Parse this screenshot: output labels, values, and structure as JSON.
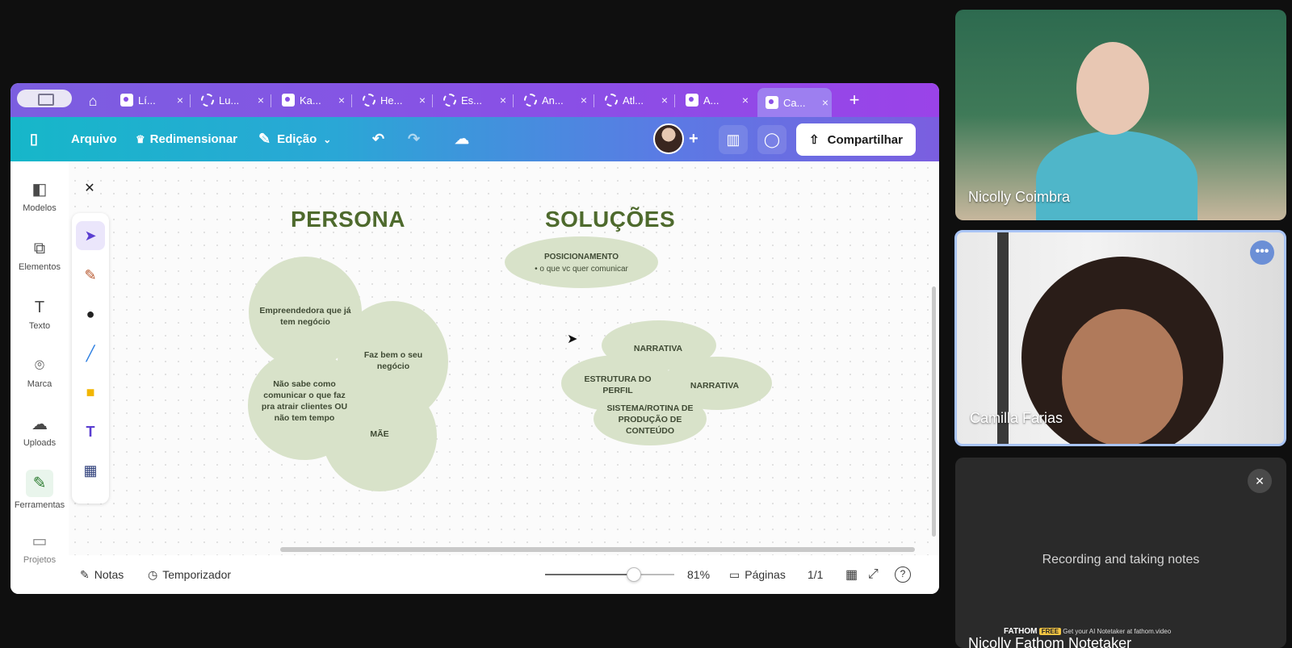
{
  "tabs": [
    {
      "title": "Lí...",
      "icon": "canva-icon",
      "active": false
    },
    {
      "title": "Lu...",
      "icon": "dashed-circle-icon",
      "active": false
    },
    {
      "title": "Ka...",
      "icon": "canva-icon",
      "active": false
    },
    {
      "title": "He...",
      "icon": "dashed-circle-icon",
      "active": false
    },
    {
      "title": "Es...",
      "icon": "dashed-circle-icon",
      "active": false
    },
    {
      "title": "An...",
      "icon": "dashed-circle-icon",
      "active": false
    },
    {
      "title": "Atl...",
      "icon": "dashed-circle-icon",
      "active": false
    },
    {
      "title": "A...",
      "icon": "canva-icon",
      "active": false
    },
    {
      "title": "Ca...",
      "icon": "canva-icon",
      "active": true
    }
  ],
  "tab_close": "×",
  "tab_new": "+",
  "toolbar": {
    "file": "Arquivo",
    "resize": "Redimensionar",
    "edit": "Edição",
    "share": "Compartilhar",
    "add": "+"
  },
  "rail": {
    "templates": "Modelos",
    "elements": "Elementos",
    "text": "Texto",
    "brand": "Marca",
    "uploads": "Uploads",
    "tools": "Ferramentas",
    "projects": "Projetos"
  },
  "canvas": {
    "persona_title": "PERSONA",
    "solucoes_title": "SOLUÇÕES",
    "persona_items": [
      "Empreendedora que já tem negócio",
      "Faz bem o seu negócio",
      "Não sabe como comunicar o que faz pra atrair clientes OU não tem tempo",
      "MÃE"
    ],
    "posicionamento": "POSICIONAMENTO",
    "posicionamento_bullet": "o que vc quer comunicar",
    "narrativa_top": "NARRATIVA",
    "estrutura": "ESTRUTURA DO PERFIL",
    "narrativa_right": "NARRATIVA",
    "sistema": "SISTEMA/ROTINA DE PRODUÇÃO DE CONTEÚDO"
  },
  "bottom": {
    "notes": "Notas",
    "timer": "Temporizador",
    "zoom": "81%",
    "zoom_value": 0.69,
    "pages": "Páginas",
    "page_count": "1/1",
    "help": "?"
  },
  "participants": {
    "p1": "Nicolly Coimbra",
    "p2": "Camilla Farias",
    "p3": "Nicolly Fathom Notetaker",
    "status": "Recording and taking notes",
    "fathom_logo": "FATHOM",
    "fathom_free": "FREE",
    "fathom_cta": "Get your AI Notetaker at fathom.video"
  },
  "colors": {
    "blob": "#d8e2c9",
    "heading": "#4e6a2d",
    "active_speaker": "#a9c4f5"
  }
}
